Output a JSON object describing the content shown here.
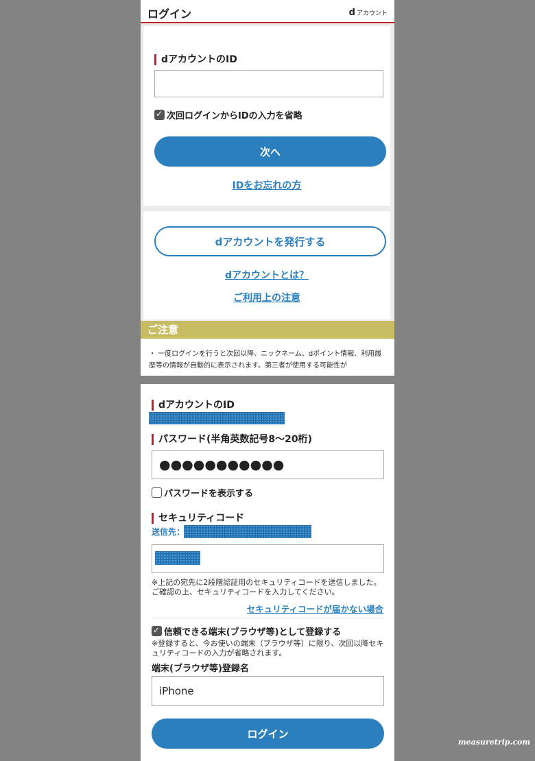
{
  "header": {
    "title": "ログイン",
    "logo_d": "d",
    "logo_text": "アカウント"
  },
  "step1": {
    "id_label": "dアカウントのID",
    "id_value": "",
    "remember_label": "次回ログインからIDの入力を省略",
    "next_button": "次へ",
    "forgot_id_link": "IDをお忘れの方",
    "issue_button": "dアカウントを発行する",
    "what_is_link": "dアカウントとは？",
    "terms_link": "ご利用上の注意"
  },
  "notice": {
    "title": "ご注意",
    "text": "・ 一度ログインを行うと次回以降、ニックネーム、dポイント情報、利用履歴等の情報が自動的に表示されます。第三者が使用する可能性が"
  },
  "step2": {
    "id_label": "dアカウントのID",
    "password_label": "パスワード(半角英数記号8〜20桁)",
    "password_value": "●●●●●●●●●●●",
    "show_password_label": "パスワードを表示する",
    "security_label": "セキュリティコード",
    "sent_to_label": "送信先：",
    "security_note": "※上記の宛先に2段階認証用のセキュリティコードを送信しました。ご確認の上、セキュリティコードを入力してください。",
    "not_received_link": "セキュリティコードが届かない場合",
    "trust_label": "信頼できる端末(ブラウザ等)として登録する",
    "trust_note": "※登録すると、今お使いの端末（ブラウザ等）に限り、次回以降セキュリティコードの入力が省略されます。",
    "device_name_label": "端末(ブラウザ等)登録名",
    "device_name_value": "iPhone",
    "login_button": "ログイン"
  },
  "watermark": "measuretrip.com",
  "colors": {
    "accent": "#2b7fbd",
    "brand_red": "#c4202f",
    "notice_bar": "#c9bd63"
  }
}
